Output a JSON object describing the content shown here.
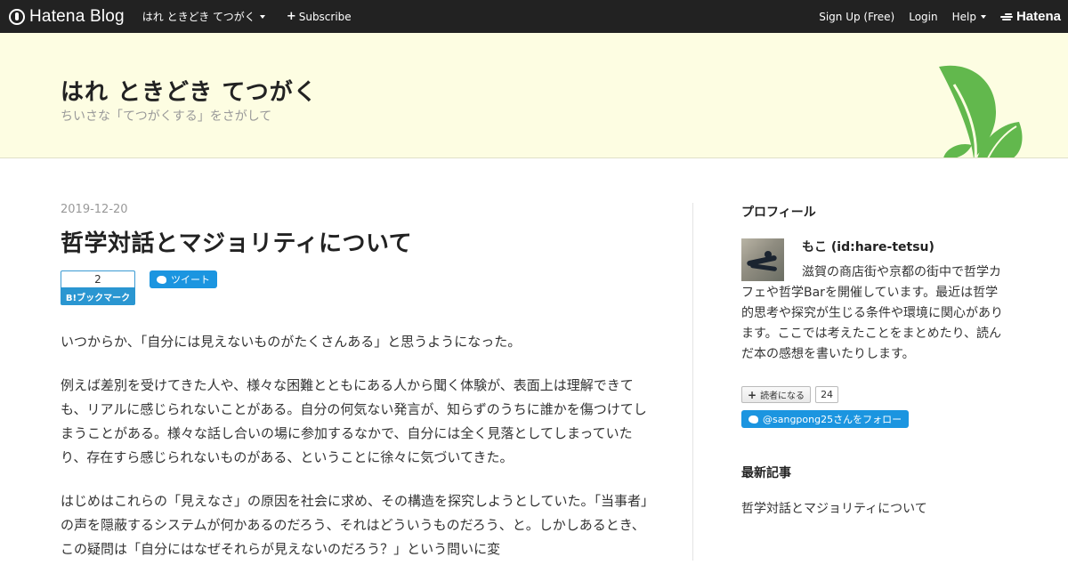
{
  "topbar": {
    "brand": "Hatena Blog",
    "blog_name": "はれ ときどき てつがく",
    "subscribe": "Subscribe",
    "signup": "Sign Up (Free)",
    "login": "Login",
    "help": "Help",
    "hatena": "Hatena"
  },
  "header": {
    "title": "はれ ときどき てつがく",
    "description": "ちいさな「てつがくする」をさがして"
  },
  "entry": {
    "date": "2019-12-20",
    "title": "哲学対話とマジョリティについて",
    "bookmark_count": "2",
    "bookmark_label": "B!ブックマーク",
    "tweet_label": "ツイート",
    "paragraphs": [
      "いつからか、「自分には見えないものがたくさんある」と思うようになった。",
      "例えば差別を受けてきた人や、様々な困難とともにある人から聞く体験が、表面上は理解できても、リアルに感じられないことがある。自分の何気ない発言が、知らずのうちに誰かを傷つけてしまうことがある。様々な話し合いの場に参加するなかで、自分には全く見落としてしまっていたり、存在すら感じられないものがある、ということに徐々に気づいてきた。",
      "はじめはこれらの「見えなさ」の原因を社会に求め、その構造を探究しようとしていた。「当事者」の声を隠蔽するシステムが何かあるのだろう、それはどういうものだろう、と。しかしあるとき、この疑問は「自分にはなぜそれらが見えないのだろう？」という問いに変"
    ]
  },
  "sidebar": {
    "profile_heading": "プロフィール",
    "profile_name": "もこ (id:hare-tetsu)",
    "profile_desc": "滋賀の商店街や京都の街中で哲学カフェや哲学Barを開催しています。最近は哲学的思考や探究が生じる条件や環境に関心があります。ここでは考えたことをまとめたり、読んだ本の感想を書いたりします。",
    "reader_button": "読者になる",
    "reader_count": "24",
    "follow_button": "@sangpong25さんをフォロー",
    "recent_heading": "最新記事",
    "recent_items": [
      "哲学対話とマジョリティについて"
    ]
  },
  "colors": {
    "topbar": "#222222",
    "header_bg": "#fdfde2",
    "leaf": "#62b84d",
    "bookmark_blue": "#2a96d1",
    "twitter_blue": "#1b95e0"
  }
}
